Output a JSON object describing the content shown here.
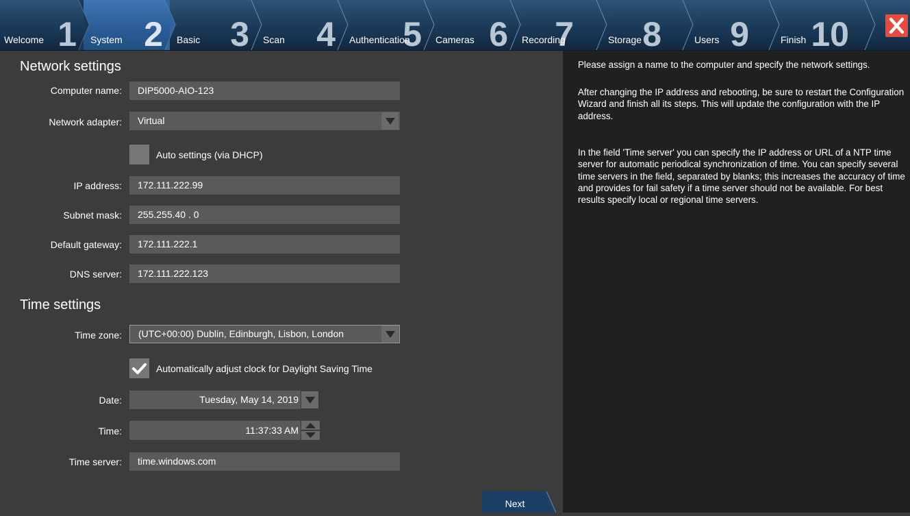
{
  "steps": [
    {
      "label": "Welcome",
      "number": "1"
    },
    {
      "label": "System",
      "number": "2"
    },
    {
      "label": "Basic",
      "number": "3"
    },
    {
      "label": "Scan",
      "number": "4"
    },
    {
      "label": "Authentication",
      "number": "5"
    },
    {
      "label": "Cameras",
      "number": "6"
    },
    {
      "label": "Recording",
      "number": "7"
    },
    {
      "label": "Storage",
      "number": "8"
    },
    {
      "label": "Users",
      "number": "9"
    },
    {
      "label": "Finish",
      "number": "10"
    }
  ],
  "active_step": "System",
  "network": {
    "title": "Network settings",
    "computer_name_label": "Computer name:",
    "computer_name": "DIP5000-AIO-123",
    "adapter_label": "Network adapter:",
    "adapter": "Virtual",
    "dhcp_label": "Auto settings (via DHCP)",
    "dhcp_checked": false,
    "ip_label": "IP address:",
    "ip": "172.111.222.99",
    "subnet_label": "Subnet mask:",
    "subnet": "255.255.40 . 0",
    "gateway_label": "Default gateway:",
    "gateway": "172.111.222.1",
    "dns_label": "DNS server:",
    "dns": "172.111.222.123"
  },
  "time": {
    "title": "Time settings",
    "zone_label": "Time zone:",
    "zone": "(UTC+00:00) Dublin, Edinburgh, Lisbon, London",
    "dst_label": "Automatically adjust clock for Daylight Saving Time",
    "dst_checked": true,
    "date_label": "Date:",
    "date": "Tuesday, May 14, 2019",
    "time_label": "Time:",
    "time": "11:37:33 AM",
    "server_label": "Time server:",
    "server": "time.windows.com"
  },
  "help": {
    "p1": "Please assign a name to the computer and specify the network settings.",
    "p2": "After changing the IP address and rebooting, be sure to restart the Configuration Wizard and finish all its steps. This will update the configuration with the IP address.",
    "p3": "In the field 'Time server' you can specify the IP address or URL of a NTP time server for automatic periodical synchronization of time. You can specify several time servers in the field, separated by blanks; this increases the accuracy of time and provides for fail safety if a time server should not be available. For best results specify local or regional time servers."
  },
  "buttons": {
    "next": "Next"
  },
  "icons": {
    "close": "close-icon",
    "checkmark": "checkmark-icon",
    "dropdown": "chevron-down-icon",
    "spinner": "up-down-icon"
  },
  "colors": {
    "close_red": "#ea4a3b",
    "active_step": "#3f76b4",
    "bar_blue": "#1b3a59",
    "next_button": "#1c3f66"
  }
}
